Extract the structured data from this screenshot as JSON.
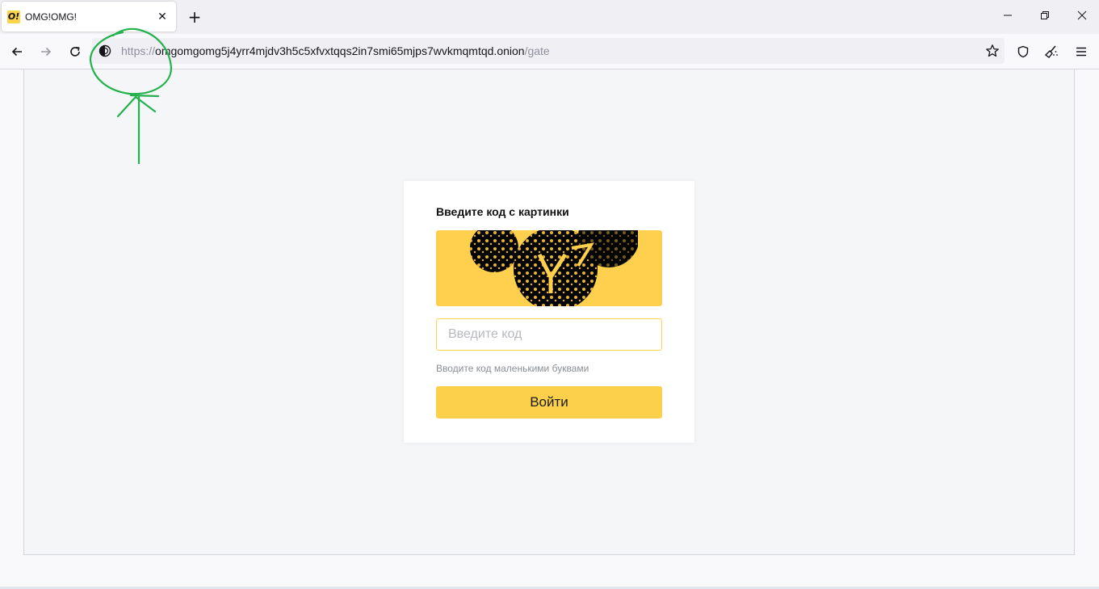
{
  "browser": {
    "tab": {
      "favicon_text": "O!",
      "title": "OMG!OMG!"
    },
    "new_tab_label": "+",
    "url": {
      "scheme": "https://",
      "host": "omgomgomg5j4yrr4mjdv3h5c5xfvxtqqs2in7smi65mjps7wvkmqmtqd.onion",
      "path": "/gate"
    }
  },
  "gate": {
    "title": "Введите код с картинки",
    "input_placeholder": "Введите код",
    "input_value": "",
    "hint": "Вводите код маленькими буквами",
    "submit_label": "Войти"
  },
  "colors": {
    "accent": "#fdd04c",
    "annotation": "#22b14c"
  }
}
